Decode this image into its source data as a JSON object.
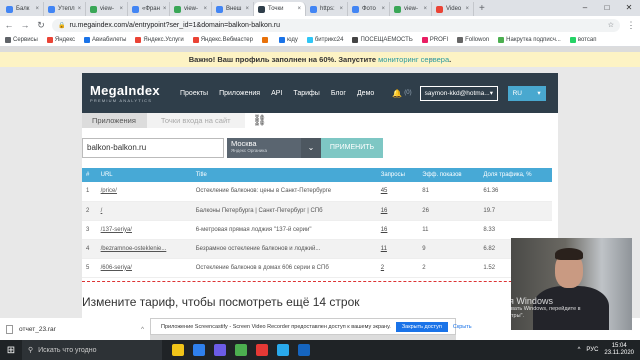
{
  "browser": {
    "tabs": [
      {
        "label": "Балк",
        "color": "#4285f4"
      },
      {
        "label": "Утепл",
        "color": "#4285f4"
      },
      {
        "label": "view-",
        "color": "#3aa757"
      },
      {
        "label": "«Фран",
        "color": "#4285f4"
      },
      {
        "label": "view-",
        "color": "#3aa757"
      },
      {
        "label": "Внеш",
        "color": "#4285f4"
      },
      {
        "label": "Точки",
        "color": "#2f3e4a"
      },
      {
        "label": "https:",
        "color": "#4285f4"
      },
      {
        "label": "Фото",
        "color": "#4285f4"
      },
      {
        "label": "view-",
        "color": "#3aa757"
      },
      {
        "label": "Video",
        "color": "#ea4335"
      }
    ],
    "active_tab_index": 6,
    "new_tab": "+",
    "url": "ru.megaindex.com/a/entrypoint?ser_id=1&domain=balkon-balkon.ru",
    "bookmarks": [
      {
        "label": "Сервисы",
        "color": "#5f6368"
      },
      {
        "label": "Яндекс",
        "color": "#ea4335"
      },
      {
        "label": "Авиабилеты",
        "color": "#1a73e8"
      },
      {
        "label": "Яндекс.Услуги",
        "color": "#ea4335"
      },
      {
        "label": "Яндекс.Вебмастер",
        "color": "#ea4335"
      },
      {
        "label": "",
        "color": "#e8710a"
      },
      {
        "label": "юду",
        "color": "#1a73e8"
      },
      {
        "label": "битрикс24",
        "color": "#2fc6f6"
      },
      {
        "label": "ПОСЕЩАЕМОСТЬ",
        "color": "#444"
      },
      {
        "label": "PROFI",
        "color": "#e91e63"
      },
      {
        "label": "Followon",
        "color": "#666"
      },
      {
        "label": "Накрутка подписч...",
        "color": "#4caf50"
      },
      {
        "label": "вотсап",
        "color": "#25d366"
      }
    ]
  },
  "notice": {
    "text": "Важно! Ваш профиль заполнен на 60%. Запустите ",
    "link": "мониторинг сервера",
    "end": ".",
    "close": "×"
  },
  "header": {
    "logo": "MegaIndex",
    "logo_sub": "PREMIUM ANALYTICS",
    "menu": [
      "Проекты",
      "Приложения",
      "API",
      "Тарифы",
      "Блог",
      "Демо"
    ],
    "notifications": "(0)",
    "user": "saymon-kkd@hotma...",
    "lang": "RU"
  },
  "breadcrumbs": {
    "first": "Приложения",
    "second": "Точки входа на сайт"
  },
  "search": {
    "domain": "balkon-balkon.ru",
    "region": "Москва",
    "engine": "Яндекс Органика",
    "apply": "ПРИМЕНИТЬ"
  },
  "table": {
    "headers": [
      "#",
      "URL",
      "Title",
      "Запросы",
      "Эфф. показов",
      "Доля трафика, %"
    ],
    "rows": [
      [
        "1",
        "/price/",
        "Остекление балконов: цены в Санкт-Петербурге",
        "45",
        "81",
        "61.36"
      ],
      [
        "2",
        "/",
        "Балконы Петербурга | Санкт-Петербург | СПб",
        "16",
        "26",
        "19.7"
      ],
      [
        "3",
        "/137-seriya/",
        "6-метровая прямая лоджия \"137-й серии\"",
        "16",
        "11",
        "8.33"
      ],
      [
        "4",
        "/bezramnoe-osteklenie...",
        "Безрамное остекление балконов и лоджий...",
        "11",
        "9",
        "6.82"
      ],
      [
        "5",
        "/606-seriya/",
        "Остекление балконов в домах 606 серии в СПб",
        "2",
        "2",
        "1.52"
      ]
    ]
  },
  "more_rows": "Измените тариф, чтобы посмотреть ещё 14 строк",
  "screencastify": {
    "text": "Приложение Screencastify - Screen Video Recorder предоставлен доступ к вашему экрану.",
    "ok": "Закрыть доступ",
    "hide": "Скрыть"
  },
  "download": {
    "file": "отчет_23.rar",
    "caret": "^",
    "close": "×"
  },
  "watermark": {
    "title": "Активация Windows",
    "line1": "Чтобы активировать Windows, перейдите в",
    "line2": "раздел \"Параметры\"."
  },
  "taskbar": {
    "search": "Искать что угодно",
    "lang": "РУС",
    "time": "15:04",
    "date": "23.11.2020",
    "app_colors": [
      "#f0c419",
      "#2f80ed",
      "#6c5ce7",
      "#4caf50",
      "#e53935",
      "#29a9eb",
      "#1565c0"
    ]
  }
}
